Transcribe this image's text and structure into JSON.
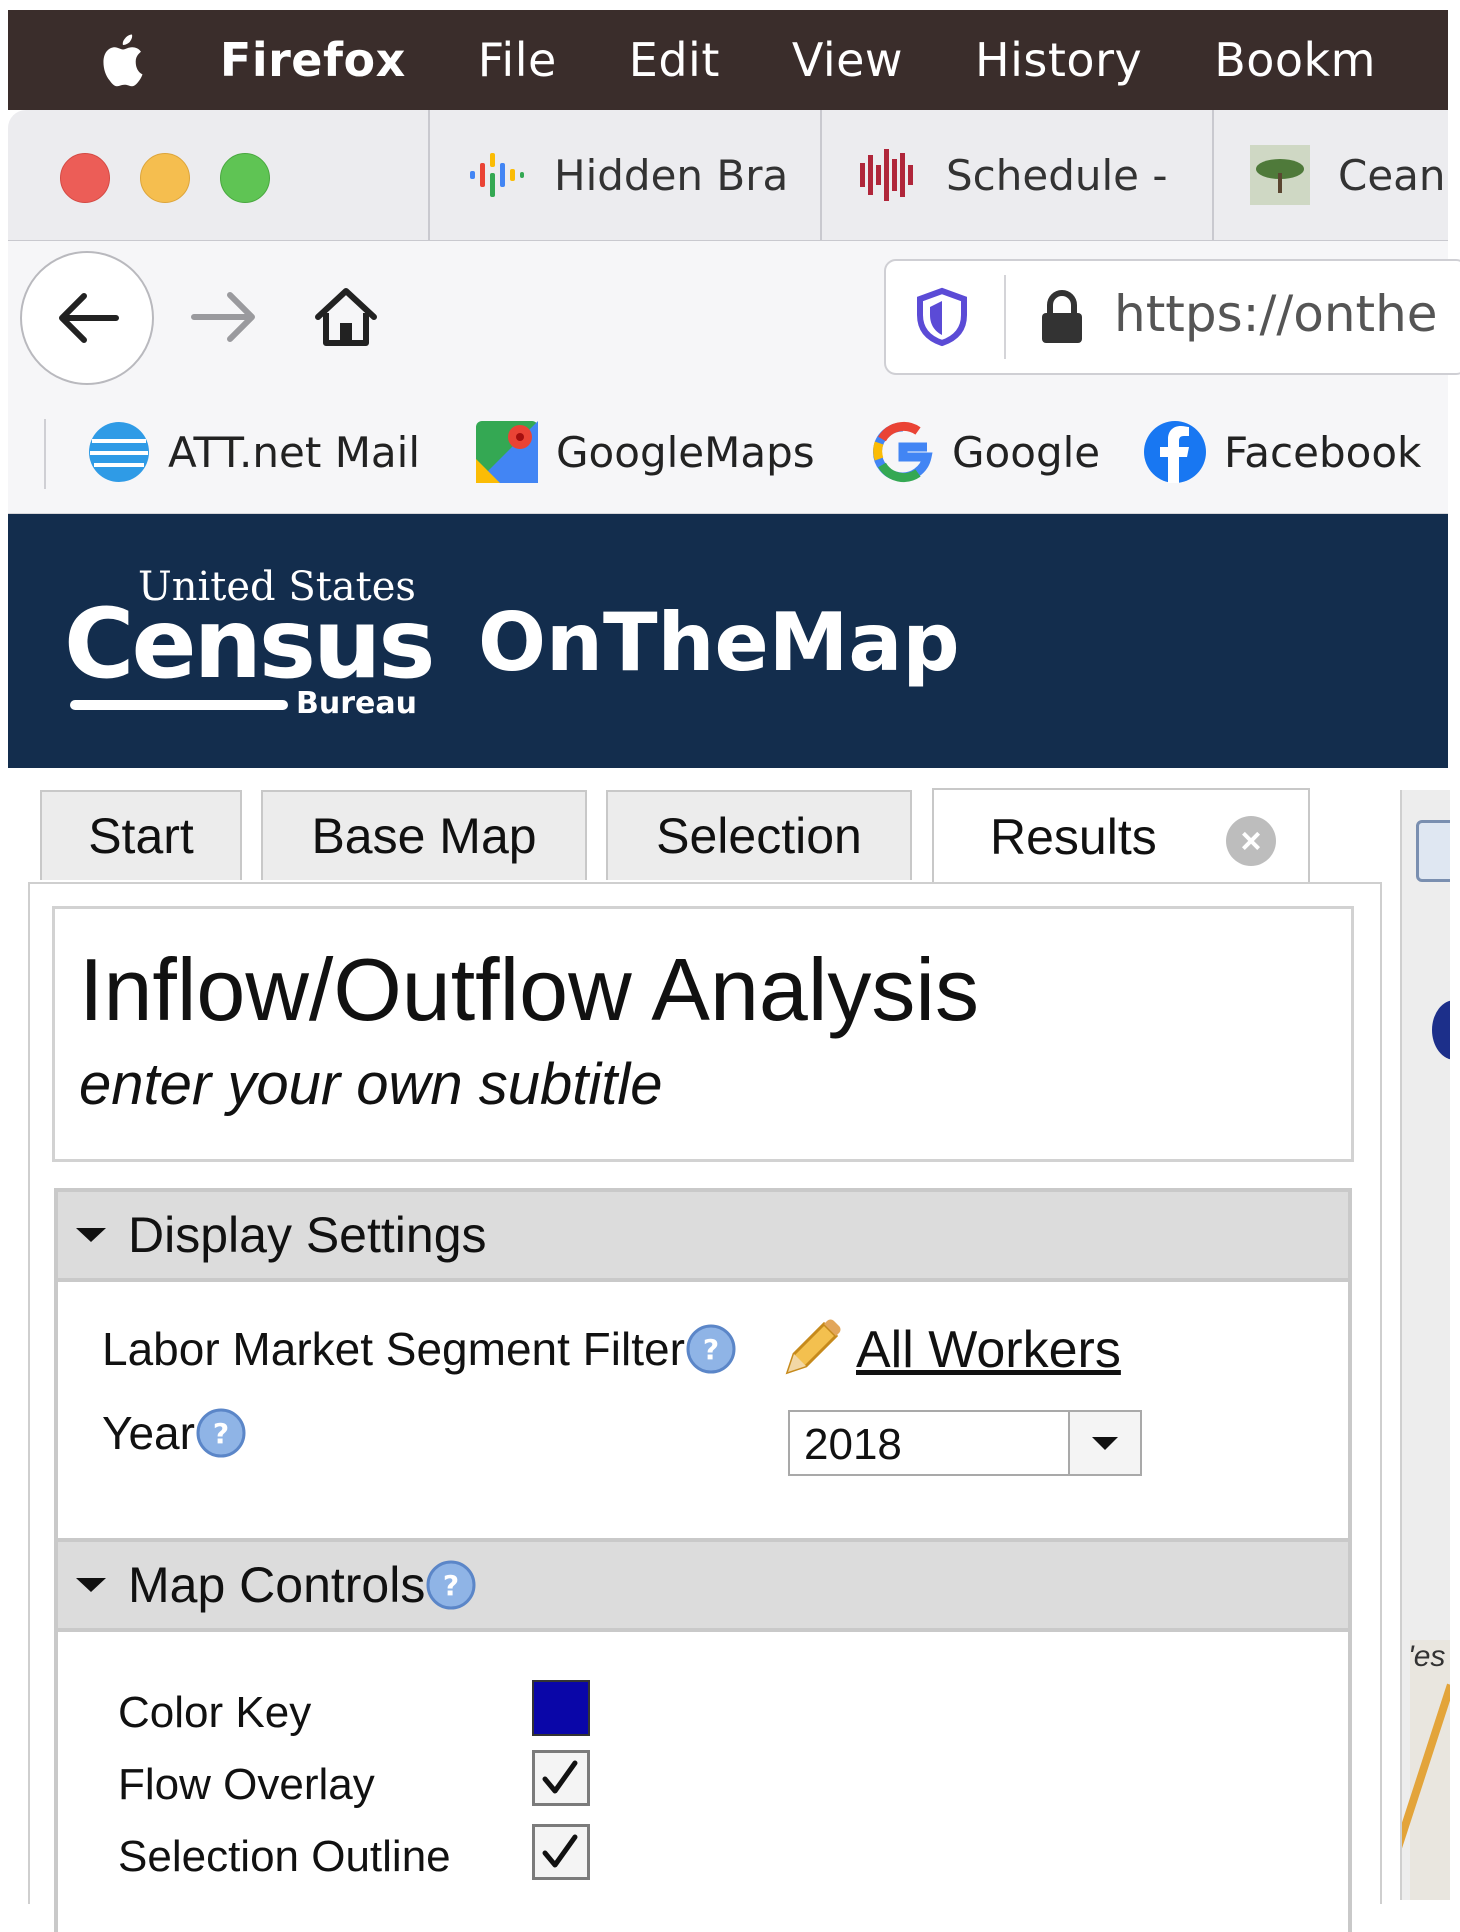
{
  "menubar": {
    "app": "Firefox",
    "items": [
      "File",
      "Edit",
      "View",
      "History",
      "Bookm"
    ]
  },
  "tabs": [
    {
      "label": "Hidden Bra",
      "icon": "podcast-icon"
    },
    {
      "label": "Schedule -",
      "icon": "waveform-icon"
    },
    {
      "label": "Cean",
      "icon": "tree-icon"
    }
  ],
  "nav": {
    "url": "https://onthe"
  },
  "bookmarks": [
    {
      "label": "ATT.net Mail",
      "icon": "att-globe-icon"
    },
    {
      "label": "GoogleMaps",
      "icon": "google-maps-icon"
    },
    {
      "label": "Google",
      "icon": "google-g-icon"
    },
    {
      "label": "Facebook",
      "icon": "facebook-icon"
    }
  ],
  "census": {
    "logo_us": "United States",
    "logo_census": "Census",
    "logo_bureau": "Bureau",
    "app_title": "OnTheMap"
  },
  "app_tabs": [
    "Start",
    "Base Map",
    "Selection",
    "Results"
  ],
  "report": {
    "title": "Inflow/Outflow Analysis",
    "subtitle": "enter your own subtitle"
  },
  "display_settings": {
    "heading": "Display Settings",
    "lmsf_label": "Labor Market Segment Filter",
    "lmsf_value": "All Workers",
    "year_label": "Year",
    "year_value": "2018"
  },
  "map_controls": {
    "heading": "Map Controls",
    "color_key_label": "Color Key",
    "flow_overlay_label": "Flow Overlay",
    "selection_outline_label": "Selection Outline",
    "flow_overlay_checked": true,
    "selection_outline_checked": true
  },
  "colors": {
    "census_navy": "#132d4d",
    "color_key": "#0a06a8"
  },
  "right_fragment": {
    "text": "'es"
  }
}
